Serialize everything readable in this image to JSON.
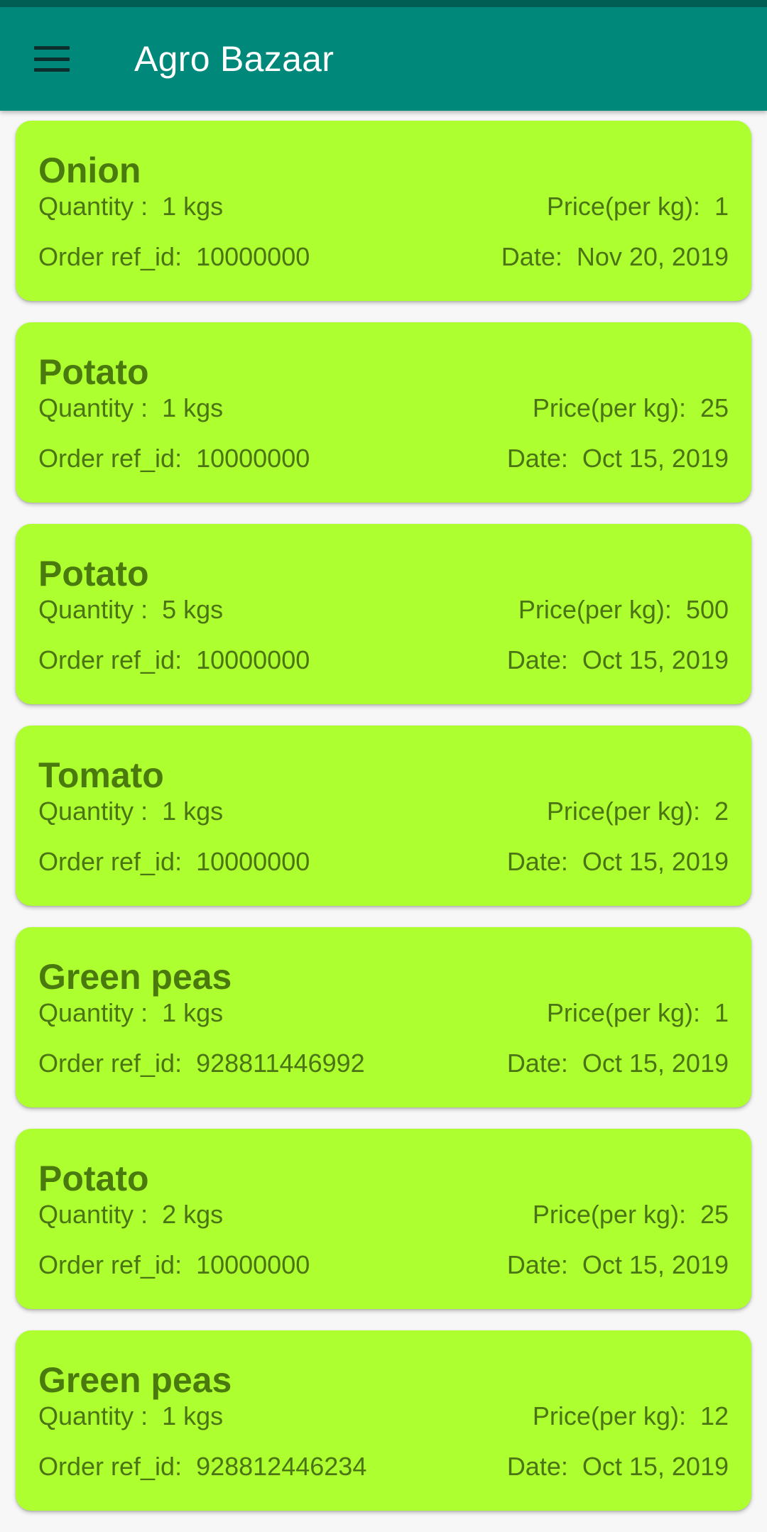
{
  "app": {
    "title": "Agro Bazaar",
    "colors": {
      "status_bar": "#005e55",
      "app_bar": "#00897b",
      "card_background": "#adff2f",
      "card_text": "#4b7514"
    },
    "menu_icon": "hamburger-menu-icon"
  },
  "labels": {
    "quantity": "Quantity :",
    "price": "Price(per kg):",
    "order_ref": "Order ref_id:",
    "date": "Date:"
  },
  "orders": [
    {
      "name": "Onion",
      "quantity": "1 kgs",
      "price": "1",
      "ref_id": "10000000",
      "date": "Nov 20, 2019"
    },
    {
      "name": "Potato",
      "quantity": "1 kgs",
      "price": "25",
      "ref_id": "10000000",
      "date": "Oct 15, 2019"
    },
    {
      "name": "Potato",
      "quantity": "5 kgs",
      "price": "500",
      "ref_id": "10000000",
      "date": "Oct 15, 2019"
    },
    {
      "name": "Tomato",
      "quantity": "1 kgs",
      "price": "2",
      "ref_id": "10000000",
      "date": "Oct 15, 2019"
    },
    {
      "name": "Green peas",
      "quantity": "1 kgs",
      "price": "1",
      "ref_id": "928811446992",
      "date": "Oct 15, 2019"
    },
    {
      "name": "Potato",
      "quantity": "2 kgs",
      "price": "25",
      "ref_id": "10000000",
      "date": "Oct 15, 2019"
    },
    {
      "name": "Green peas",
      "quantity": "1 kgs",
      "price": "12",
      "ref_id": "928812446234",
      "date": "Oct 15, 2019"
    }
  ]
}
